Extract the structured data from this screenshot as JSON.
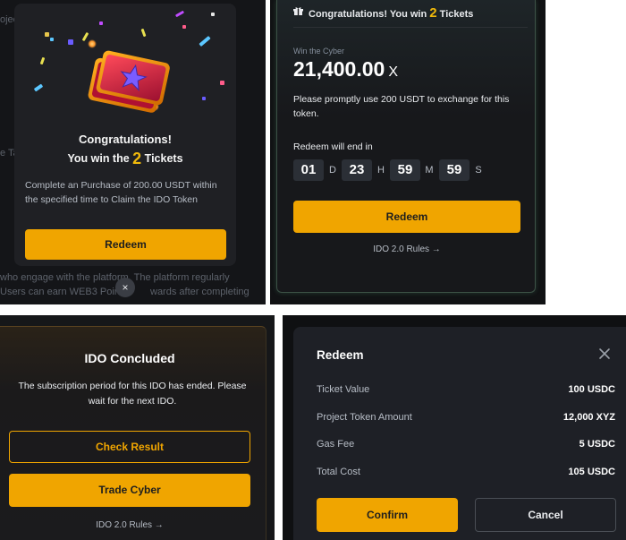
{
  "panel1": {
    "background_text": [
      "ojec",
      "e Ta",
      "who engage with the platform. The platform regularly",
      "Users can earn WEB3 Points",
      "wards after completing"
    ],
    "title": "Congratulations!",
    "subtitle_prefix": "You win the",
    "ticket_count": "2",
    "subtitle_suffix": "Tickets",
    "description": "Complete an Purchase of 200.00 USDT within the specified time to Claim the IDO Token",
    "redeem_label": "Redeem",
    "close_symbol": "×"
  },
  "panel2": {
    "header_prefix": "Congratulations! You win",
    "ticket_count": "2",
    "header_suffix": "Tickets",
    "win_label": "Win the Cyber",
    "amount": "21,400.00",
    "amount_unit": "X",
    "description": "Please promptly use 200 USDT to exchange for this token.",
    "countdown_label": "Redeem will end in",
    "countdown": [
      {
        "value": "01",
        "unit": "D"
      },
      {
        "value": "23",
        "unit": "H"
      },
      {
        "value": "59",
        "unit": "M"
      },
      {
        "value": "59",
        "unit": "S"
      }
    ],
    "redeem_label": "Redeem",
    "rules_link": "IDO 2.0 Rules →"
  },
  "panel3": {
    "title": "IDO Concluded",
    "description": "The subscription period for this IDO has ended. Please wait  for the next IDO.",
    "check_result_label": "Check Result",
    "trade_label": "Trade Cyber",
    "rules_link": "IDO 2.0 Rules →"
  },
  "panel4": {
    "title": "Redeem",
    "rows": [
      {
        "label": "Ticket Value",
        "value": "100 USDC"
      },
      {
        "label": "Project Token Amount",
        "value": "12,000 XYZ"
      },
      {
        "label": "Gas Fee",
        "value": "5 USDC"
      },
      {
        "label": "Total Cost",
        "value": "105 USDC"
      }
    ],
    "confirm_label": "Confirm",
    "cancel_label": "Cancel"
  },
  "colors": {
    "accent": "#f0a500",
    "ticket_number": "#f0b90b",
    "dark_bg": "#1e2026"
  },
  "icons": [
    "ticket-icon",
    "gift-icon",
    "close-icon",
    "arrow-right-icon"
  ]
}
